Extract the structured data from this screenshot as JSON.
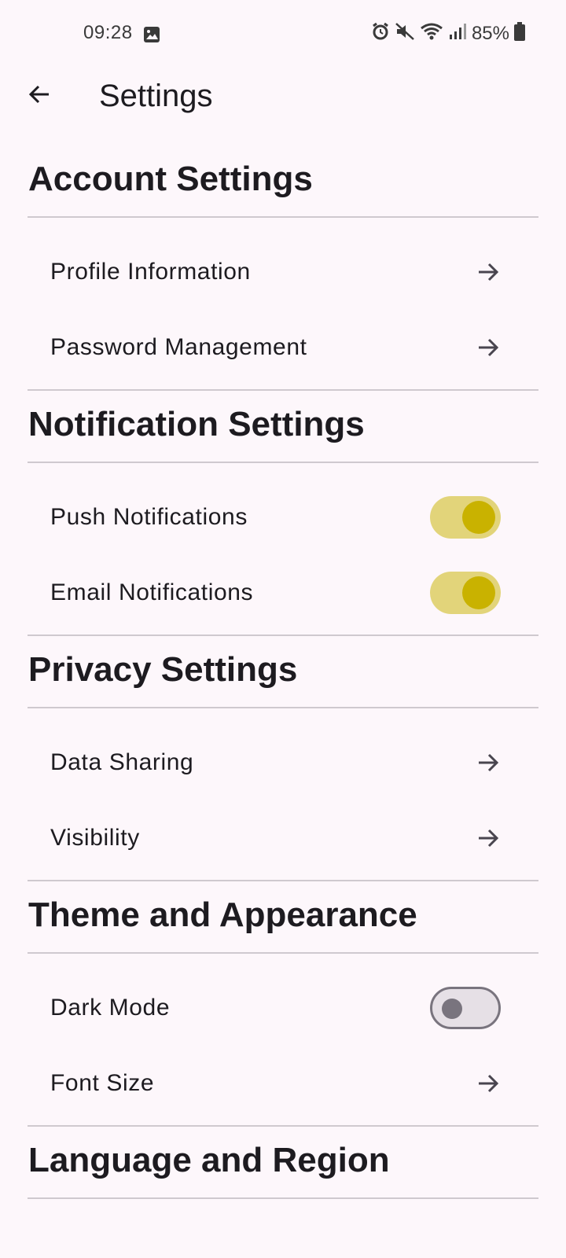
{
  "status_bar": {
    "time": "09:28",
    "battery": "85%",
    "icons": [
      "image-icon",
      "alarm-icon",
      "mute-icon",
      "wifi-icon",
      "signal-icon",
      "battery-icon"
    ]
  },
  "app_bar": {
    "title": "Settings",
    "back_icon": "arrow-back-icon"
  },
  "sections": [
    {
      "title": "Account Settings",
      "items": [
        {
          "label": "Profile Information",
          "control": "arrow"
        },
        {
          "label": "Password Management",
          "control": "arrow"
        }
      ]
    },
    {
      "title": "Notification Settings",
      "items": [
        {
          "label": "Push Notifications",
          "control": "switch",
          "on": true
        },
        {
          "label": "Email Notifications",
          "control": "switch",
          "on": true
        }
      ]
    },
    {
      "title": "Privacy Settings",
      "items": [
        {
          "label": "Data Sharing",
          "control": "arrow"
        },
        {
          "label": "Visibility",
          "control": "arrow"
        }
      ]
    },
    {
      "title": "Theme and Appearance",
      "items": [
        {
          "label": "Dark Mode",
          "control": "switch",
          "on": false
        },
        {
          "label": "Font Size",
          "control": "arrow"
        }
      ]
    },
    {
      "title": "Language and Region",
      "items": []
    }
  ],
  "colors": {
    "background": "#fdf7fb",
    "switch_track_on": "#e2d47a",
    "switch_thumb_on": "#c9b200",
    "switch_outline_off": "#79747e"
  }
}
